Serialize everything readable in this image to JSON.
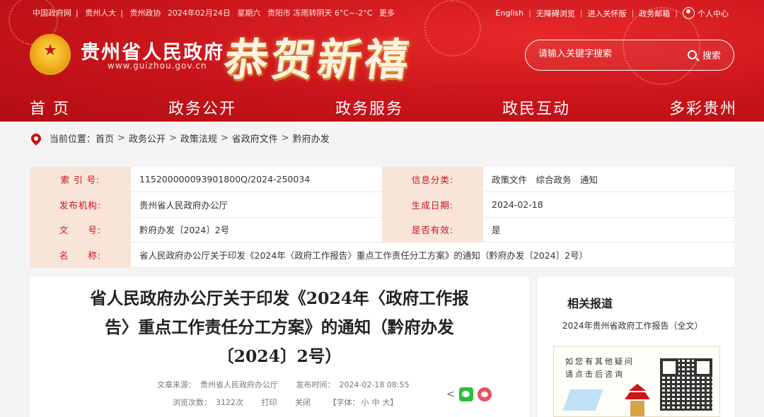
{
  "topbar": {
    "links": [
      "中国政府网",
      "贵州人大",
      "贵州政协"
    ],
    "date": "2024年02月24日",
    "weekday": "星期六",
    "weather": "贵阳市 冻雨转阴天 6°C~-2°C",
    "more": "更多",
    "english": "English",
    "accessible": "无障碍浏览",
    "elder": "进入关怀版",
    "mailbox": "政务邮箱",
    "personal": "个人中心"
  },
  "header": {
    "site_title": "贵州省人民政府",
    "site_url": "www.guizhou.gov.cn",
    "greeting": "恭贺新禧"
  },
  "search": {
    "placeholder": "请输入关键字搜索",
    "button": "搜索"
  },
  "nav": [
    "首 页",
    "政务公开",
    "政务服务",
    "政民互动",
    "多彩贵州"
  ],
  "breadcrumb": {
    "label": "当前位置：",
    "items": [
      "首页",
      "政务公开",
      "政策法规",
      "省政府文件",
      "黔府办发"
    ]
  },
  "info": {
    "index_label": "索 引 号:",
    "index_value": "115200000093901800Q/2024-250034",
    "category_label": "信息分类:",
    "category_value": "政策文件　综合政务　通知",
    "publisher_label": "发布机构:",
    "publisher_value": "贵州省人民政府办公厅",
    "date_label": "生成日期:",
    "date_value": "2024-02-18",
    "docno_label": "文　　号:",
    "docno_value": "黔府办发〔2024〕2号",
    "valid_label": "是否有效:",
    "valid_value": "是",
    "name_label": "名　　称:",
    "name_value": "省人民政府办公厅关于印发《2024年〈政府工作报告〉重点工作责任分工方案》的通知（黔府办发〔2024〕2号）"
  },
  "article": {
    "title_line1": "省人民政府办公厅关于印发《2024年〈政府工作报",
    "title_line2": "告〉重点工作责任分工方案》的通知（黔府办发",
    "title_line3": "〔2024〕2号）",
    "source_label": "文章来源：",
    "source": "贵州省人民政府办公厅",
    "time_label": "发布时间：",
    "time": "2024-02-18 08:55",
    "views_label": "浏览次数：",
    "views": "3122次",
    "print": "打印",
    "close": "关闭",
    "font_label": "【字体：",
    "font_small": "小",
    "font_medium": "中",
    "font_large": "大",
    "font_end": "】"
  },
  "sidebar": {
    "title": "相关报道",
    "link": "2024年贵州省政府工作报告（全文）",
    "qr_line1": "如您有其他疑问",
    "qr_line2": "请点击后咨询"
  }
}
